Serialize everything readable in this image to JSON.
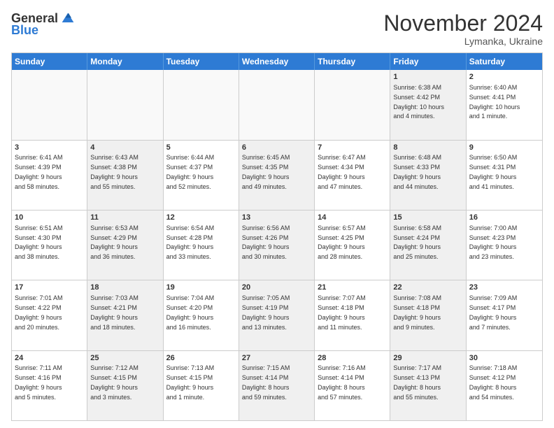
{
  "header": {
    "logo_general": "General",
    "logo_blue": "Blue",
    "title": "November 2024",
    "location": "Lymanka, Ukraine"
  },
  "days": [
    "Sunday",
    "Monday",
    "Tuesday",
    "Wednesday",
    "Thursday",
    "Friday",
    "Saturday"
  ],
  "rows": [
    [
      {
        "day": "",
        "info": "",
        "empty": true
      },
      {
        "day": "",
        "info": "",
        "empty": true
      },
      {
        "day": "",
        "info": "",
        "empty": true
      },
      {
        "day": "",
        "info": "",
        "empty": true
      },
      {
        "day": "",
        "info": "",
        "empty": true
      },
      {
        "day": "1",
        "info": "Sunrise: 6:38 AM\nSunset: 4:42 PM\nDaylight: 10 hours\nand 4 minutes.",
        "empty": false,
        "shaded": true
      },
      {
        "day": "2",
        "info": "Sunrise: 6:40 AM\nSunset: 4:41 PM\nDaylight: 10 hours\nand 1 minute.",
        "empty": false,
        "shaded": false
      }
    ],
    [
      {
        "day": "3",
        "info": "Sunrise: 6:41 AM\nSunset: 4:39 PM\nDaylight: 9 hours\nand 58 minutes.",
        "empty": false,
        "shaded": false
      },
      {
        "day": "4",
        "info": "Sunrise: 6:43 AM\nSunset: 4:38 PM\nDaylight: 9 hours\nand 55 minutes.",
        "empty": false,
        "shaded": true
      },
      {
        "day": "5",
        "info": "Sunrise: 6:44 AM\nSunset: 4:37 PM\nDaylight: 9 hours\nand 52 minutes.",
        "empty": false,
        "shaded": false
      },
      {
        "day": "6",
        "info": "Sunrise: 6:45 AM\nSunset: 4:35 PM\nDaylight: 9 hours\nand 49 minutes.",
        "empty": false,
        "shaded": true
      },
      {
        "day": "7",
        "info": "Sunrise: 6:47 AM\nSunset: 4:34 PM\nDaylight: 9 hours\nand 47 minutes.",
        "empty": false,
        "shaded": false
      },
      {
        "day": "8",
        "info": "Sunrise: 6:48 AM\nSunset: 4:33 PM\nDaylight: 9 hours\nand 44 minutes.",
        "empty": false,
        "shaded": true
      },
      {
        "day": "9",
        "info": "Sunrise: 6:50 AM\nSunset: 4:31 PM\nDaylight: 9 hours\nand 41 minutes.",
        "empty": false,
        "shaded": false
      }
    ],
    [
      {
        "day": "10",
        "info": "Sunrise: 6:51 AM\nSunset: 4:30 PM\nDaylight: 9 hours\nand 38 minutes.",
        "empty": false,
        "shaded": false
      },
      {
        "day": "11",
        "info": "Sunrise: 6:53 AM\nSunset: 4:29 PM\nDaylight: 9 hours\nand 36 minutes.",
        "empty": false,
        "shaded": true
      },
      {
        "day": "12",
        "info": "Sunrise: 6:54 AM\nSunset: 4:28 PM\nDaylight: 9 hours\nand 33 minutes.",
        "empty": false,
        "shaded": false
      },
      {
        "day": "13",
        "info": "Sunrise: 6:56 AM\nSunset: 4:26 PM\nDaylight: 9 hours\nand 30 minutes.",
        "empty": false,
        "shaded": true
      },
      {
        "day": "14",
        "info": "Sunrise: 6:57 AM\nSunset: 4:25 PM\nDaylight: 9 hours\nand 28 minutes.",
        "empty": false,
        "shaded": false
      },
      {
        "day": "15",
        "info": "Sunrise: 6:58 AM\nSunset: 4:24 PM\nDaylight: 9 hours\nand 25 minutes.",
        "empty": false,
        "shaded": true
      },
      {
        "day": "16",
        "info": "Sunrise: 7:00 AM\nSunset: 4:23 PM\nDaylight: 9 hours\nand 23 minutes.",
        "empty": false,
        "shaded": false
      }
    ],
    [
      {
        "day": "17",
        "info": "Sunrise: 7:01 AM\nSunset: 4:22 PM\nDaylight: 9 hours\nand 20 minutes.",
        "empty": false,
        "shaded": false
      },
      {
        "day": "18",
        "info": "Sunrise: 7:03 AM\nSunset: 4:21 PM\nDaylight: 9 hours\nand 18 minutes.",
        "empty": false,
        "shaded": true
      },
      {
        "day": "19",
        "info": "Sunrise: 7:04 AM\nSunset: 4:20 PM\nDaylight: 9 hours\nand 16 minutes.",
        "empty": false,
        "shaded": false
      },
      {
        "day": "20",
        "info": "Sunrise: 7:05 AM\nSunset: 4:19 PM\nDaylight: 9 hours\nand 13 minutes.",
        "empty": false,
        "shaded": true
      },
      {
        "day": "21",
        "info": "Sunrise: 7:07 AM\nSunset: 4:18 PM\nDaylight: 9 hours\nand 11 minutes.",
        "empty": false,
        "shaded": false
      },
      {
        "day": "22",
        "info": "Sunrise: 7:08 AM\nSunset: 4:18 PM\nDaylight: 9 hours\nand 9 minutes.",
        "empty": false,
        "shaded": true
      },
      {
        "day": "23",
        "info": "Sunrise: 7:09 AM\nSunset: 4:17 PM\nDaylight: 9 hours\nand 7 minutes.",
        "empty": false,
        "shaded": false
      }
    ],
    [
      {
        "day": "24",
        "info": "Sunrise: 7:11 AM\nSunset: 4:16 PM\nDaylight: 9 hours\nand 5 minutes.",
        "empty": false,
        "shaded": false
      },
      {
        "day": "25",
        "info": "Sunrise: 7:12 AM\nSunset: 4:15 PM\nDaylight: 9 hours\nand 3 minutes.",
        "empty": false,
        "shaded": true
      },
      {
        "day": "26",
        "info": "Sunrise: 7:13 AM\nSunset: 4:15 PM\nDaylight: 9 hours\nand 1 minute.",
        "empty": false,
        "shaded": false
      },
      {
        "day": "27",
        "info": "Sunrise: 7:15 AM\nSunset: 4:14 PM\nDaylight: 8 hours\nand 59 minutes.",
        "empty": false,
        "shaded": true
      },
      {
        "day": "28",
        "info": "Sunrise: 7:16 AM\nSunset: 4:14 PM\nDaylight: 8 hours\nand 57 minutes.",
        "empty": false,
        "shaded": false
      },
      {
        "day": "29",
        "info": "Sunrise: 7:17 AM\nSunset: 4:13 PM\nDaylight: 8 hours\nand 55 minutes.",
        "empty": false,
        "shaded": true
      },
      {
        "day": "30",
        "info": "Sunrise: 7:18 AM\nSunset: 4:12 PM\nDaylight: 8 hours\nand 54 minutes.",
        "empty": false,
        "shaded": false
      }
    ]
  ]
}
